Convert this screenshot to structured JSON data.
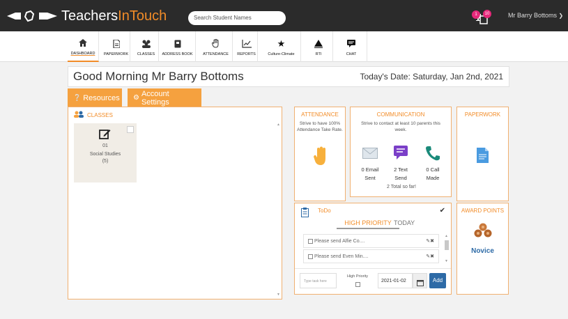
{
  "header": {
    "logo_main": "Teachers",
    "logo_accent": "InTouch",
    "search_placeholder": "Search Student Names",
    "notif_badge_1": "1",
    "notif_badge_2": "10",
    "user_name": "Mr Barry Bottoms"
  },
  "nav": {
    "items": [
      {
        "label": "DASHBOARD",
        "icon": "home-icon"
      },
      {
        "label": "PAPERWORK",
        "icon": "document-icon"
      },
      {
        "label": "CLASSES",
        "icon": "users-icon"
      },
      {
        "label": "ADDRESS BOOK",
        "icon": "book-icon"
      },
      {
        "label": "ATTENDANCE",
        "icon": "hand-icon"
      },
      {
        "label": "REPORTS",
        "icon": "line-chart-icon"
      },
      {
        "label": "Culture-Climate",
        "icon": "star-icon"
      },
      {
        "label": "RTI",
        "icon": "pyramid-icon"
      },
      {
        "label": "CHAT",
        "icon": "chat-icon"
      }
    ]
  },
  "greeting": {
    "text": "Good Morning Mr Barry Bottoms",
    "date": "Today's Date: Saturday, Jan 2nd, 2021"
  },
  "buttons": {
    "resources": "Resources",
    "account_settings": "Account Settings"
  },
  "classes": {
    "title": "CLASSES",
    "cards": [
      {
        "number": "01",
        "name": "Social Studies",
        "count": "(5)"
      }
    ]
  },
  "attendance": {
    "title": "ATTENDANCE",
    "subtitle": "Strive to have 100% Attendance Take Rate."
  },
  "communication": {
    "title": "COMMUNICATION",
    "subtitle": "Strive to contact at least 10 parents this week.",
    "email_count": "0 Email",
    "email_state": "Sent",
    "text_count": "2 Text",
    "text_state": "Send",
    "call_count": "0 Call",
    "call_state": "Made",
    "total": "2 Total so far!"
  },
  "paperwork": {
    "title": "PAPERWORK"
  },
  "award_points": {
    "title": "AWARD POINTS",
    "level": "Novice"
  },
  "todo": {
    "title": "ToDo",
    "tab_high": "HIGH PRIORITY",
    "tab_today": "TODAY",
    "tasks": [
      {
        "text": "Please send Alfie Co...."
      },
      {
        "text": "Please send Even Min...."
      }
    ],
    "input_placeholder": "Type task here",
    "high_priority_label": "High Priority",
    "date_value": "2021-01-02",
    "add_label": "Add"
  },
  "colors": {
    "accent": "#f28c28",
    "topbar": "#2b2b2b",
    "badge": "#e6287a",
    "add_button": "#2d6aa6"
  }
}
